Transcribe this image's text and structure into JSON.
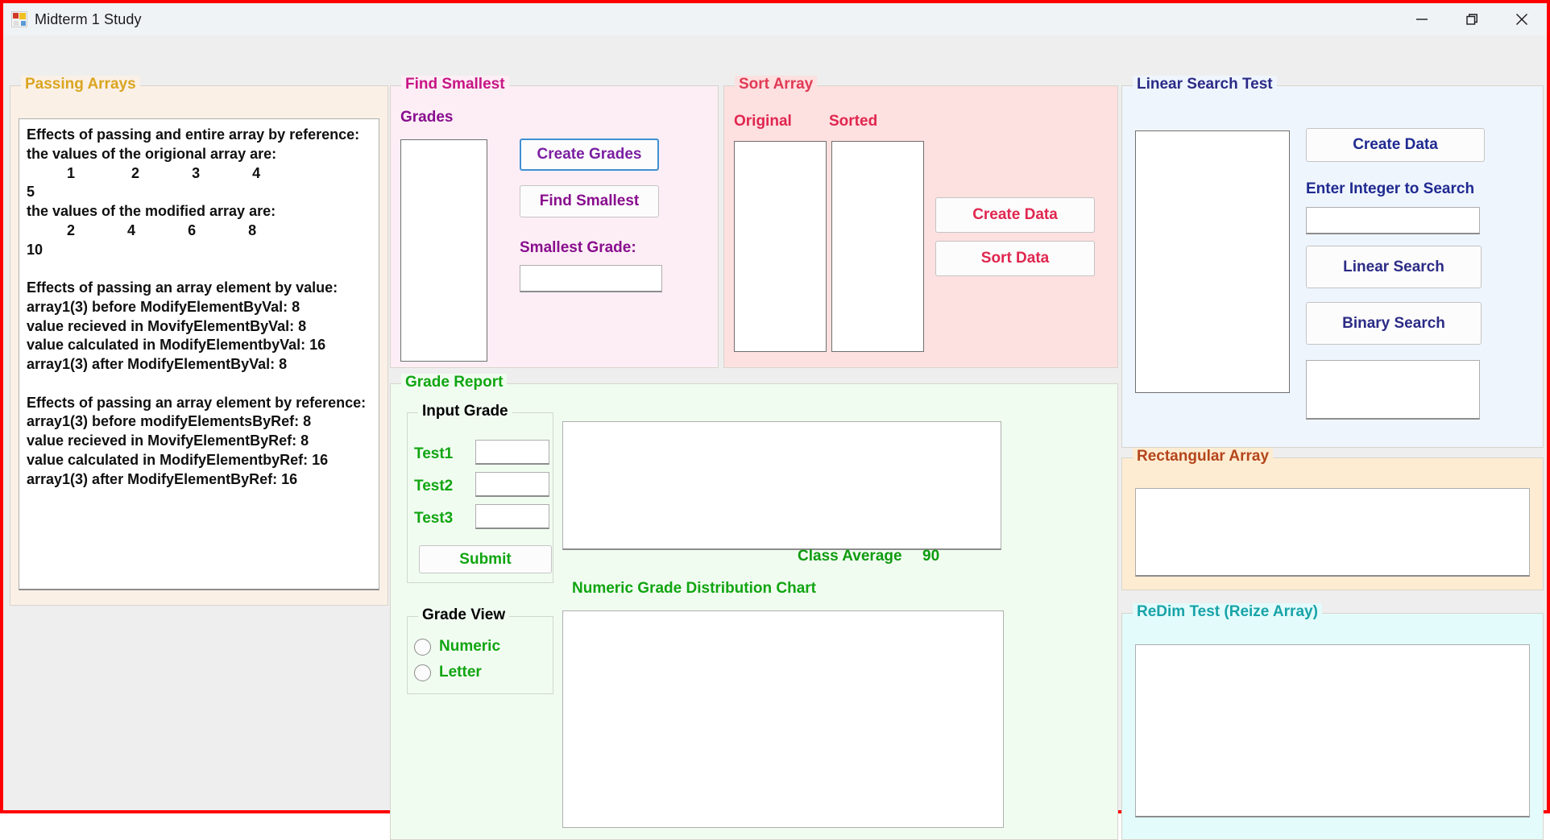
{
  "window": {
    "title": "Midterm 1 Study",
    "app_icon": "vb-form-icon",
    "controls": {
      "minimize": "minimize-icon",
      "maximize": "restore-icon",
      "close": "close-icon"
    },
    "border_color": "#ff0000"
  },
  "passing_arrays": {
    "title": "Passing Arrays",
    "accent": "#daa520",
    "output": "Effects of passing and entire array by reference:\nthe values of the origional array are:\n          1              2             3             4\n5\nthe values of the modified array are:\n          2             4             6             8\n10\n\nEffects of passing an array element by value:\narray1(3) before ModifyElementByVal: 8\nvalue recieved in MovifyElementByVal: 8\nvalue calculated in ModifyElementbyVal: 16\narray1(3) after ModifyElementByVal: 8\n\nEffects of passing an array element by reference:\narray1(3) before modifyElementsByRef: 8\nvalue recieved in MovifyElementByRef: 8\nvalue calculated in ModifyElementbyRef: 16\narray1(3) after ModifyElementByRef: 16"
  },
  "find_smallest": {
    "title": "Find Smallest",
    "accent": "#c71585",
    "grades_label": "Grades",
    "grades_list_items": [],
    "create_grades_button": "Create Grades",
    "find_smallest_button": "Find Smallest",
    "smallest_grade_label": "Smallest Grade:",
    "smallest_grade_value": ""
  },
  "sort_array": {
    "title": "Sort Array",
    "accent": "#e0264f",
    "original_label": "Original",
    "sorted_label": "Sorted",
    "original_items": [],
    "sorted_items": [],
    "create_data_button": "Create Data",
    "sort_data_button": "Sort Data"
  },
  "linear_search": {
    "title": "Linear Search Test",
    "accent": "#2b2b86",
    "data_list_items": [],
    "create_data_button": "Create Data",
    "enter_integer_label": "Enter Integer to Search",
    "search_value": "",
    "linear_search_button": "Linear Search",
    "binary_search_button": "Binary Search",
    "result_value": ""
  },
  "rectangular_array": {
    "title": "Rectangular Array",
    "accent": "#b5451b",
    "output": ""
  },
  "redim_test": {
    "title": "ReDim Test (Reize Array)",
    "accent": "#18a3a8",
    "output": ""
  },
  "grade_report": {
    "title": "Grade Report",
    "accent": "#11a511",
    "input_grade": {
      "title": "Input Grade",
      "test1_label": "Test1",
      "test1_value": "",
      "test2_label": "Test2",
      "test2_value": "",
      "test3_label": "Test3",
      "test3_value": "",
      "submit_button": "Submit"
    },
    "grade_view": {
      "title": "Grade View",
      "numeric_label": "Numeric",
      "numeric_selected": false,
      "letter_label": "Letter",
      "letter_selected": false
    },
    "report_output": "",
    "class_average_label": "Class Average",
    "class_average_value": "90",
    "chart_label": "Numeric Grade Distribution Chart",
    "chart_content": ""
  }
}
